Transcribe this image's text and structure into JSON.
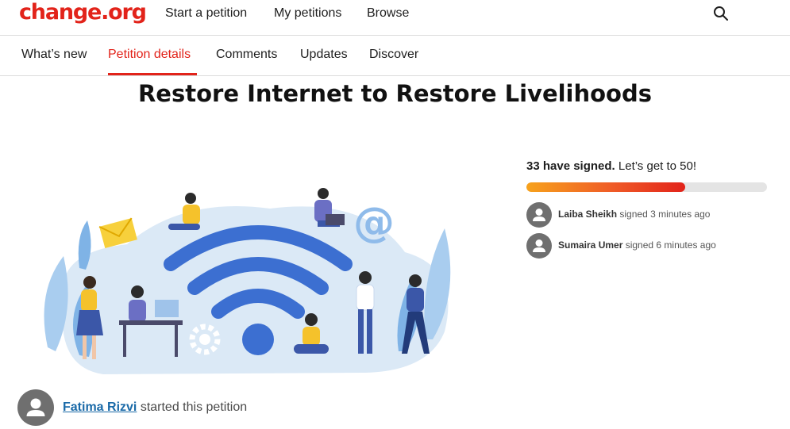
{
  "header": {
    "logo": "change.org",
    "nav": [
      "Start a petition",
      "My petitions",
      "Browse"
    ],
    "search_icon": "search-icon"
  },
  "tabs": [
    "What’s new",
    "Petition details",
    "Comments",
    "Updates",
    "Discover"
  ],
  "active_tab": "Petition details",
  "petition": {
    "title": "Restore Internet to Restore Livelihoods",
    "hero_image": "people-with-devices-around-wifi-illustration"
  },
  "signatures": {
    "count_text": "33 have signed.",
    "goal_text": "Let’s get to 50!",
    "count": 33,
    "goal": 50,
    "recent": [
      {
        "name": "Laiba Sheikh",
        "action": "signed 3 minutes ago"
      },
      {
        "name": "Sumaira Umer",
        "action": "signed 6 minutes ago"
      }
    ]
  },
  "starter": {
    "name": "Fatima Rizvi",
    "action": "started this petition"
  },
  "colors": {
    "brand": "#e2231a",
    "link": "#1a6aa8",
    "progress_start": "#f7a21c",
    "progress_end": "#e2231a"
  }
}
